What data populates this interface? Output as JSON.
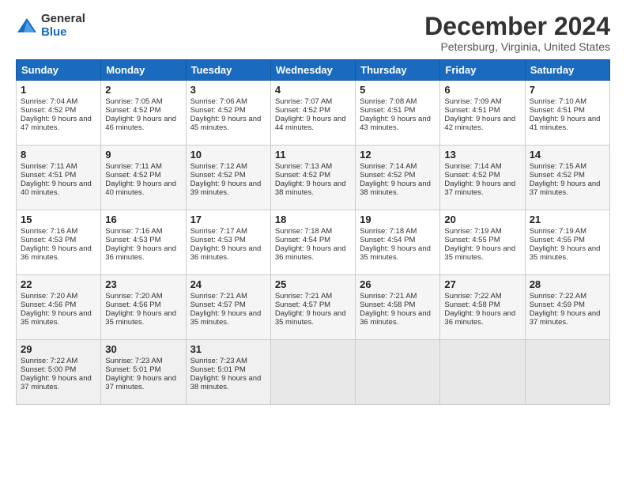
{
  "logo": {
    "general": "General",
    "blue": "Blue"
  },
  "header": {
    "title": "December 2024",
    "subtitle": "Petersburg, Virginia, United States"
  },
  "weekdays": [
    "Sunday",
    "Monday",
    "Tuesday",
    "Wednesday",
    "Thursday",
    "Friday",
    "Saturday"
  ],
  "weeks": [
    [
      {
        "day": "1",
        "sunrise": "7:04 AM",
        "sunset": "4:52 PM",
        "daylight": "9 hours and 47 minutes."
      },
      {
        "day": "2",
        "sunrise": "7:05 AM",
        "sunset": "4:52 PM",
        "daylight": "9 hours and 46 minutes."
      },
      {
        "day": "3",
        "sunrise": "7:06 AM",
        "sunset": "4:52 PM",
        "daylight": "9 hours and 45 minutes."
      },
      {
        "day": "4",
        "sunrise": "7:07 AM",
        "sunset": "4:52 PM",
        "daylight": "9 hours and 44 minutes."
      },
      {
        "day": "5",
        "sunrise": "7:08 AM",
        "sunset": "4:51 PM",
        "daylight": "9 hours and 43 minutes."
      },
      {
        "day": "6",
        "sunrise": "7:09 AM",
        "sunset": "4:51 PM",
        "daylight": "9 hours and 42 minutes."
      },
      {
        "day": "7",
        "sunrise": "7:10 AM",
        "sunset": "4:51 PM",
        "daylight": "9 hours and 41 minutes."
      }
    ],
    [
      {
        "day": "8",
        "sunrise": "7:11 AM",
        "sunset": "4:51 PM",
        "daylight": "9 hours and 40 minutes."
      },
      {
        "day": "9",
        "sunrise": "7:11 AM",
        "sunset": "4:52 PM",
        "daylight": "9 hours and 40 minutes."
      },
      {
        "day": "10",
        "sunrise": "7:12 AM",
        "sunset": "4:52 PM",
        "daylight": "9 hours and 39 minutes."
      },
      {
        "day": "11",
        "sunrise": "7:13 AM",
        "sunset": "4:52 PM",
        "daylight": "9 hours and 38 minutes."
      },
      {
        "day": "12",
        "sunrise": "7:14 AM",
        "sunset": "4:52 PM",
        "daylight": "9 hours and 38 minutes."
      },
      {
        "day": "13",
        "sunrise": "7:14 AM",
        "sunset": "4:52 PM",
        "daylight": "9 hours and 37 minutes."
      },
      {
        "day": "14",
        "sunrise": "7:15 AM",
        "sunset": "4:52 PM",
        "daylight": "9 hours and 37 minutes."
      }
    ],
    [
      {
        "day": "15",
        "sunrise": "7:16 AM",
        "sunset": "4:53 PM",
        "daylight": "9 hours and 36 minutes."
      },
      {
        "day": "16",
        "sunrise": "7:16 AM",
        "sunset": "4:53 PM",
        "daylight": "9 hours and 36 minutes."
      },
      {
        "day": "17",
        "sunrise": "7:17 AM",
        "sunset": "4:53 PM",
        "daylight": "9 hours and 36 minutes."
      },
      {
        "day": "18",
        "sunrise": "7:18 AM",
        "sunset": "4:54 PM",
        "daylight": "9 hours and 36 minutes."
      },
      {
        "day": "19",
        "sunrise": "7:18 AM",
        "sunset": "4:54 PM",
        "daylight": "9 hours and 35 minutes."
      },
      {
        "day": "20",
        "sunrise": "7:19 AM",
        "sunset": "4:55 PM",
        "daylight": "9 hours and 35 minutes."
      },
      {
        "day": "21",
        "sunrise": "7:19 AM",
        "sunset": "4:55 PM",
        "daylight": "9 hours and 35 minutes."
      }
    ],
    [
      {
        "day": "22",
        "sunrise": "7:20 AM",
        "sunset": "4:56 PM",
        "daylight": "9 hours and 35 minutes."
      },
      {
        "day": "23",
        "sunrise": "7:20 AM",
        "sunset": "4:56 PM",
        "daylight": "9 hours and 35 minutes."
      },
      {
        "day": "24",
        "sunrise": "7:21 AM",
        "sunset": "4:57 PM",
        "daylight": "9 hours and 35 minutes."
      },
      {
        "day": "25",
        "sunrise": "7:21 AM",
        "sunset": "4:57 PM",
        "daylight": "9 hours and 35 minutes."
      },
      {
        "day": "26",
        "sunrise": "7:21 AM",
        "sunset": "4:58 PM",
        "daylight": "9 hours and 36 minutes."
      },
      {
        "day": "27",
        "sunrise": "7:22 AM",
        "sunset": "4:58 PM",
        "daylight": "9 hours and 36 minutes."
      },
      {
        "day": "28",
        "sunrise": "7:22 AM",
        "sunset": "4:59 PM",
        "daylight": "9 hours and 37 minutes."
      }
    ],
    [
      {
        "day": "29",
        "sunrise": "7:22 AM",
        "sunset": "5:00 PM",
        "daylight": "9 hours and 37 minutes."
      },
      {
        "day": "30",
        "sunrise": "7:23 AM",
        "sunset": "5:01 PM",
        "daylight": "9 hours and 37 minutes."
      },
      {
        "day": "31",
        "sunrise": "7:23 AM",
        "sunset": "5:01 PM",
        "daylight": "9 hours and 38 minutes."
      },
      null,
      null,
      null,
      null
    ]
  ]
}
